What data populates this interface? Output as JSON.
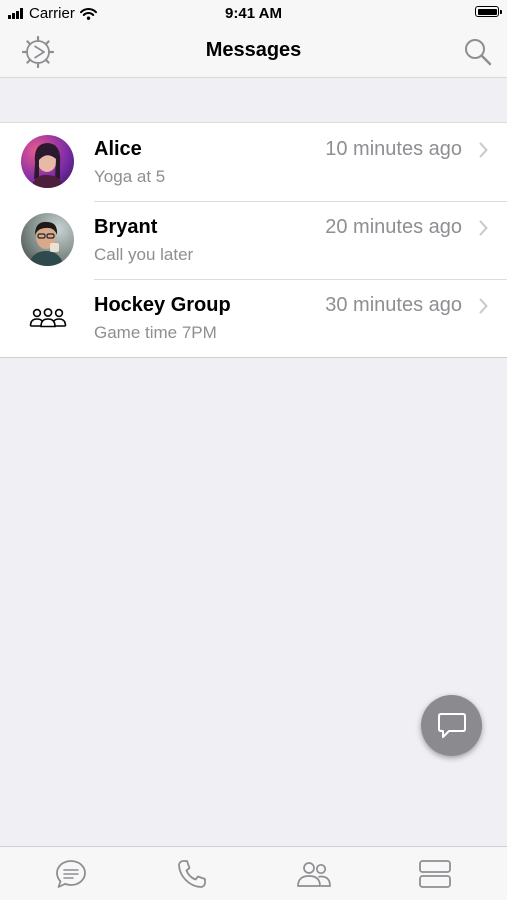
{
  "status_bar": {
    "carrier": "Carrier",
    "time": "9:41 AM"
  },
  "nav": {
    "title": "Messages",
    "left_icon": "settings-gear-icon",
    "right_icon": "search-icon"
  },
  "conversations": [
    {
      "name": "Alice",
      "preview": "Yoga at 5",
      "time": "10 minutes ago",
      "avatar": "photo"
    },
    {
      "name": "Bryant",
      "preview": "Call you later",
      "time": "20 minutes ago",
      "avatar": "photo"
    },
    {
      "name": "Hockey Group",
      "preview": "Game time 7PM",
      "time": "30 minutes ago",
      "avatar": "group-icon"
    }
  ],
  "fab": {
    "icon": "new-message-icon"
  },
  "tabs": [
    {
      "icon": "chat-bubble-icon"
    },
    {
      "icon": "phone-icon"
    },
    {
      "icon": "contacts-icon"
    },
    {
      "icon": "more-icon"
    }
  ],
  "colors": {
    "background": "#efeff4",
    "bar": "#f7f7f7",
    "secondary_text": "#8e8e93",
    "fab": "#8a8a8f"
  }
}
